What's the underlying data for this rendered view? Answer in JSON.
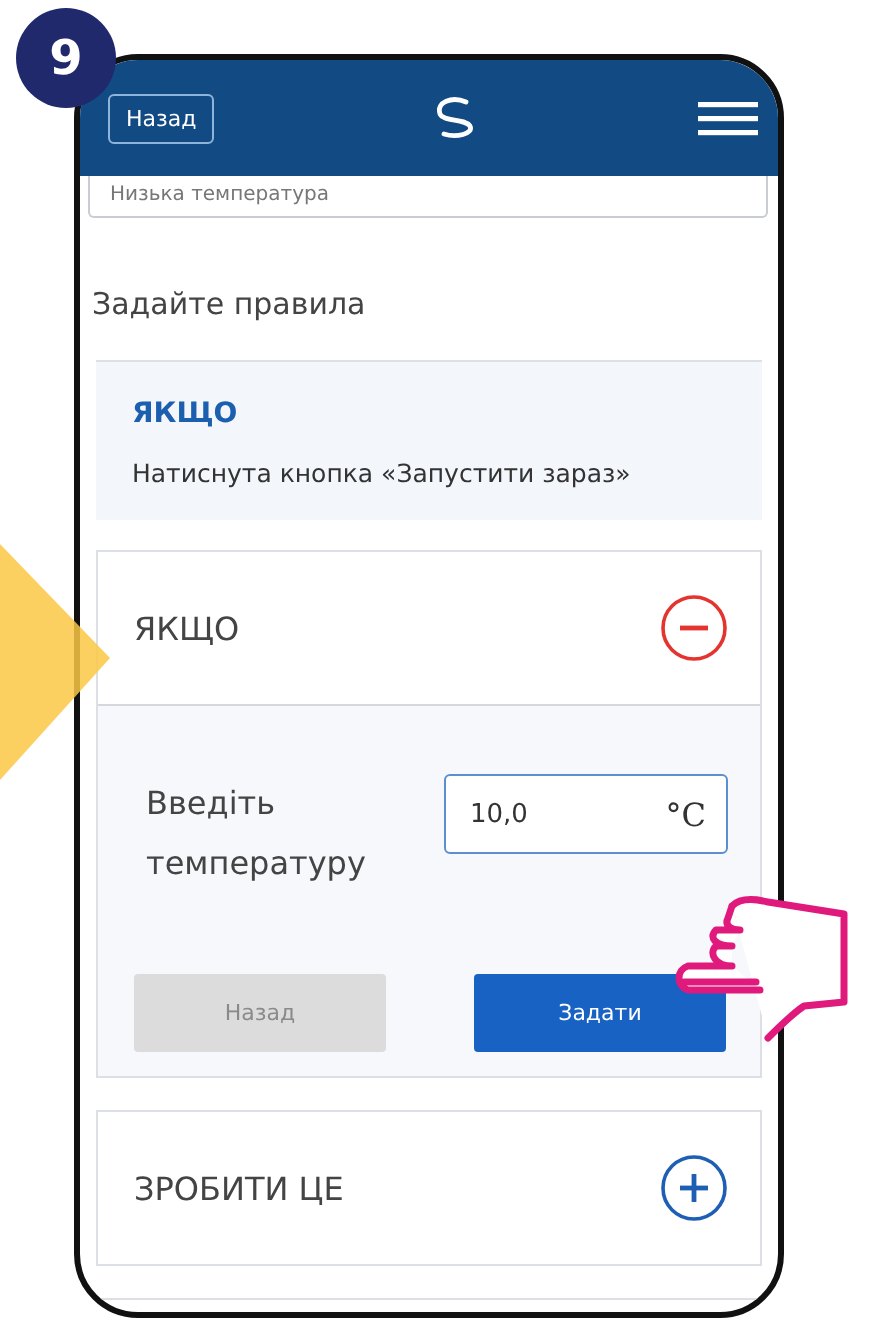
{
  "step_badge": "9",
  "header": {
    "back_button": "Назад"
  },
  "name_field": {
    "value": "Низька температура"
  },
  "section_title": "Задайте правила",
  "rule_summary": {
    "title": "ЯКЩО",
    "text": "Натиснута кнопка «Запустити зараз»"
  },
  "cards": [
    {
      "title": "ЯКЩО",
      "expanded": true,
      "label": "Введіть температуру",
      "value": "10,0",
      "unit": "°C",
      "buttons": [
        {
          "label": "Назад",
          "disabled": true
        },
        {
          "label": "Задати",
          "disabled": false
        }
      ]
    },
    {
      "title": "ЗРОБИТИ ЦЕ",
      "expanded": false
    }
  ]
}
